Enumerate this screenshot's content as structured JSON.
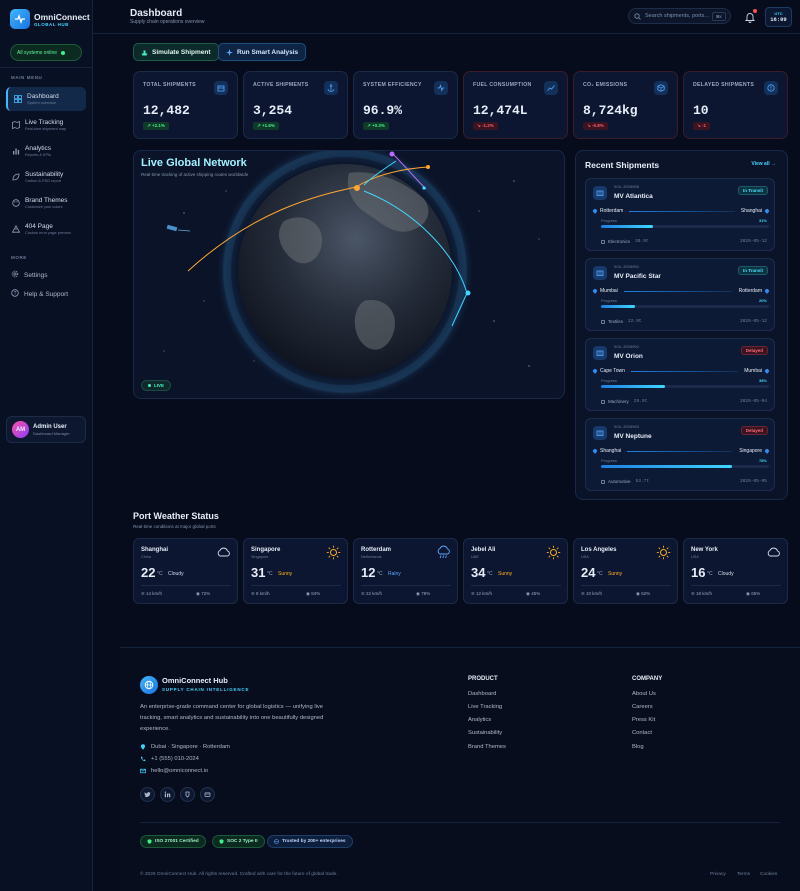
{
  "brand": {
    "name": "OmniConnect",
    "sub": "GLOBAL HUB"
  },
  "status": "All systems online",
  "sidebar": {
    "main_label": "MAIN MENU",
    "items": [
      {
        "title": "Dashboard",
        "sub": "System overview",
        "icon": "grid-icon"
      },
      {
        "title": "Live Tracking",
        "sub": "Real-time shipment map",
        "icon": "map-icon"
      },
      {
        "title": "Analytics",
        "sub": "Reports & KPIs",
        "icon": "bar-chart-icon"
      },
      {
        "title": "Sustainability",
        "sub": "Carbon & ESG report",
        "icon": "leaf-icon"
      },
      {
        "title": "Brand Themes",
        "sub": "Customize your colors",
        "icon": "palette-icon"
      },
      {
        "title": "404 Page",
        "sub": "Custom error page preview",
        "icon": "warning-icon"
      }
    ],
    "more_label": "MORE",
    "more": [
      {
        "title": "Settings",
        "icon": "gear-icon"
      },
      {
        "title": "Help & Support",
        "icon": "help-icon"
      }
    ]
  },
  "user": {
    "initials": "AM",
    "name": "Admin User",
    "role": "Dashboard Manager"
  },
  "header": {
    "title": "Dashboard",
    "subtitle": "Supply chain operations overview",
    "search_placeholder": "Search shipments, ports...",
    "search_kbd": "⌘K",
    "tz": "UTC",
    "time": "16:09"
  },
  "actions": {
    "simulate": "Simulate Shipment",
    "analysis": "Run Smart Analysis"
  },
  "kpis": [
    {
      "label": "TOTAL SHIPMENTS",
      "value": "12,482",
      "delta": "↗ +2.1%",
      "dir": "up",
      "icon": "package-icon"
    },
    {
      "label": "ACTIVE SHIPMENTS",
      "value": "3,254",
      "delta": "↗ +1.6%",
      "dir": "up",
      "icon": "anchor-icon"
    },
    {
      "label": "SYSTEM EFFICIENCY",
      "value": "96.9%",
      "delta": "↗ +0.3%",
      "dir": "up",
      "icon": "pulse-icon"
    },
    {
      "label": "FUEL CONSUMPTION",
      "value": "12,474L",
      "delta": "↘ -1.2%",
      "dir": "down",
      "icon": "trend-icon"
    },
    {
      "label": "CO₂ EMISSIONS",
      "value": "8,724kg",
      "delta": "↘ -0.8%",
      "dir": "down",
      "icon": "cube-icon"
    },
    {
      "label": "DELAYED SHIPMENTS",
      "value": "10",
      "delta": "↘ -1",
      "dir": "down",
      "icon": "alert-icon"
    }
  ],
  "globe": {
    "title": "Live Global Network",
    "subtitle": "Real-time tracking of active shipping routes worldwide",
    "live": "LIVE"
  },
  "recent": {
    "title": "Recent Shipments",
    "view_all": "View all →",
    "progress_label": "Progress",
    "items": [
      {
        "id": "OCN-2026008",
        "name": "MV Atlantica",
        "status": "In Transit",
        "kind": "transit",
        "origin": "Rotterdam",
        "dest": "Shanghai",
        "progress_text": "31%",
        "progress": 0.31,
        "cargo": "Electronics",
        "weight": "30.9t",
        "date": "2026-05-12"
      },
      {
        "id": "OCN-2026001",
        "name": "MV Pacific Star",
        "status": "In Transit",
        "kind": "transit",
        "origin": "Mumbai",
        "dest": "Rotterdam",
        "progress_text": "20%",
        "progress": 0.2,
        "cargo": "Textiles",
        "weight": "22.9t",
        "date": "2026-05-12"
      },
      {
        "id": "OCN-2026002",
        "name": "MV Orion",
        "status": "Delayed",
        "kind": "delayed",
        "origin": "Cape Town",
        "dest": "Mumbai",
        "progress_text": "38%",
        "progress": 0.38,
        "cargo": "Machinery",
        "weight": "29.9t",
        "date": "2026-05-04"
      },
      {
        "id": "OCN-2026003",
        "name": "MV Neptune",
        "status": "Delayed",
        "kind": "delayed",
        "origin": "Shanghai",
        "dest": "Singapore",
        "progress_text": "78%",
        "progress": 0.78,
        "cargo": "Automotive",
        "weight": "53.7t",
        "date": "2026-05-05"
      }
    ]
  },
  "weather": {
    "title": "Port Weather Status",
    "subtitle": "Real-time conditions at major global ports",
    "unit": "°C",
    "ports": [
      {
        "city": "Shanghai",
        "country": "China",
        "temp": "22",
        "cond": "Cloudy",
        "wind": "14 km/h",
        "hum": "72%",
        "icon": "cloud-icon",
        "cond_color": "#d5deec"
      },
      {
        "city": "Singapore",
        "country": "Singapore",
        "temp": "31",
        "cond": "Sunny",
        "wind": "8 km/h",
        "hum": "84%",
        "icon": "sun-icon",
        "cond_color": "#ffb020"
      },
      {
        "city": "Rotterdam",
        "country": "Netherlands",
        "temp": "12",
        "cond": "Rainy",
        "wind": "22 km/h",
        "hum": "78%",
        "icon": "rain-icon",
        "cond_color": "#5aa8ff"
      },
      {
        "city": "Jebel Ali",
        "country": "UAE",
        "temp": "34",
        "cond": "Sunny",
        "wind": "12 km/h",
        "hum": "45%",
        "icon": "sun-icon",
        "cond_color": "#ffb020"
      },
      {
        "city": "Los Angeles",
        "country": "USA",
        "temp": "24",
        "cond": "Sunny",
        "wind": "10 km/h",
        "hum": "62%",
        "icon": "sun-icon",
        "cond_color": "#ffb020"
      },
      {
        "city": "New York",
        "country": "USA",
        "temp": "16",
        "cond": "Cloudy",
        "wind": "18 km/h",
        "hum": "65%",
        "icon": "cloud-icon",
        "cond_color": "#d5deec"
      }
    ]
  },
  "footer": {
    "name": "OmniConnect Hub",
    "tagline": "SUPPLY CHAIN INTELLIGENCE",
    "desc": "An enterprise-grade command center for global logistics — unifying live tracking, smart analytics and sustainability into one beautifully designed experience.",
    "location": "Dubai · Singapore · Rotterdam",
    "phone": "+1 (555) 010-2024",
    "email": "hello@omniconnect.io",
    "social": [
      "twitter-icon",
      "linkedin-icon",
      "github-icon",
      "mail-icon"
    ],
    "product_title": "PRODUCT",
    "product": [
      "Dashboard",
      "Live Tracking",
      "Analytics",
      "Sustainability",
      "Brand Themes"
    ],
    "company_title": "COMPANY",
    "company": [
      "About Us",
      "Careers",
      "Press Kit",
      "Contact",
      "Blog"
    ],
    "certs": [
      "ISO 27001 Certified",
      "SOC 2 Type II",
      "Trusted by 200+ enterprises"
    ],
    "copyright": "© 2026 OmniConnect Hub. All rights reserved. Crafted with care for the future of global trade.",
    "legal": [
      "Privacy",
      "Terms",
      "Cookies"
    ]
  },
  "colors": {
    "accent": "#3fd6ff",
    "brand": "#1873e0",
    "success": "#3ff08a",
    "danger": "#ff5a6e",
    "background": "#060c1c"
  }
}
